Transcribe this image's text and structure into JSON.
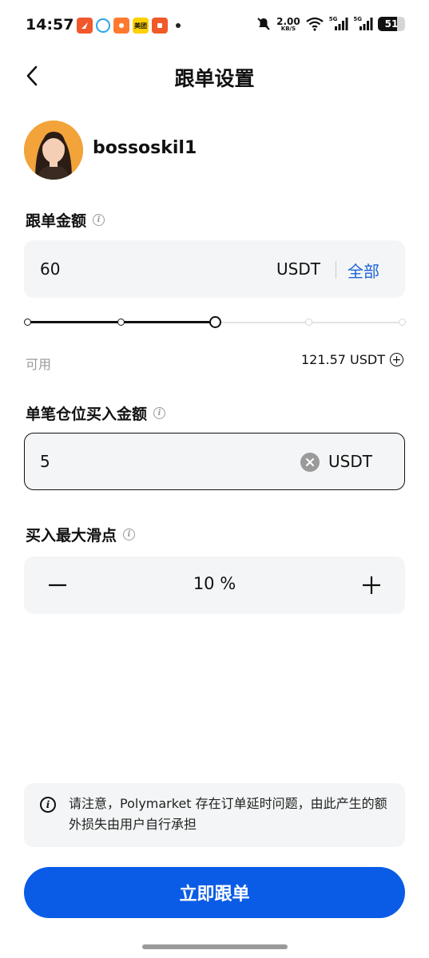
{
  "status_bar": {
    "time": "14:57",
    "notif_4_text": "美团",
    "net_speed_value": "2.00",
    "net_speed_unit": "KB/S",
    "signal_1": "5G",
    "signal_2": "5G",
    "battery": "51"
  },
  "header": {
    "title": "跟单设置"
  },
  "profile": {
    "username": "bossoskil1"
  },
  "amount": {
    "label": "跟单金额",
    "value": "60",
    "unit": "USDT",
    "all_label": "全部"
  },
  "slider": {
    "stops": 5,
    "selected_stop": 3
  },
  "available": {
    "label": "可用",
    "value": "121.57 USDT"
  },
  "per_position": {
    "label": "单笔仓位买入金额",
    "value": "5",
    "unit": "USDT"
  },
  "slippage": {
    "label": "买入最大滑点",
    "value": "10 %"
  },
  "notice": {
    "text": "请注意，Polymarket 存在订单延时问题，由此产生的额外损失由用户自行承担"
  },
  "submit": {
    "label": "立即跟单"
  },
  "colors": {
    "accent": "#0a5ce6",
    "link": "#1b63d8",
    "field_bg": "#f4f5f6"
  }
}
